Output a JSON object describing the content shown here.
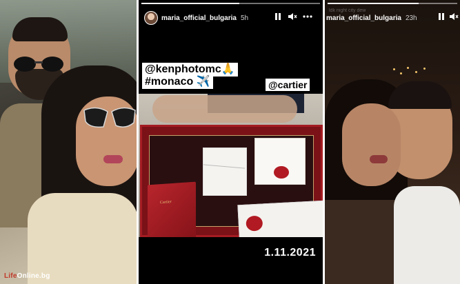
{
  "left_panel": {
    "watermark_brand": "Life",
    "watermark_rest": "Online.bg"
  },
  "middle_story": {
    "username": "maria_official_bulgaria",
    "time": "5h",
    "progress_percent": 55,
    "tag_kenphoto": "@kenphotomc🙏",
    "tag_monaco": "#monaco ✈️",
    "tag_cartier": "@cartier",
    "box_logo": "Cartier",
    "date": "1.11.2021",
    "icons": [
      "pause-icon",
      "mute-icon",
      "more-icon"
    ]
  },
  "right_story": {
    "faded_text": "ldk night city dew",
    "username": "maria_official_bulgaria",
    "time": "23h",
    "progress_percent": 70,
    "icons": [
      "pause-icon",
      "mute-icon",
      "more-icon"
    ]
  },
  "colors": {
    "accent_red": "#c0392b",
    "story_bg": "#000000",
    "tray_red": "#7a1218",
    "wax_seal": "#b11a22"
  }
}
